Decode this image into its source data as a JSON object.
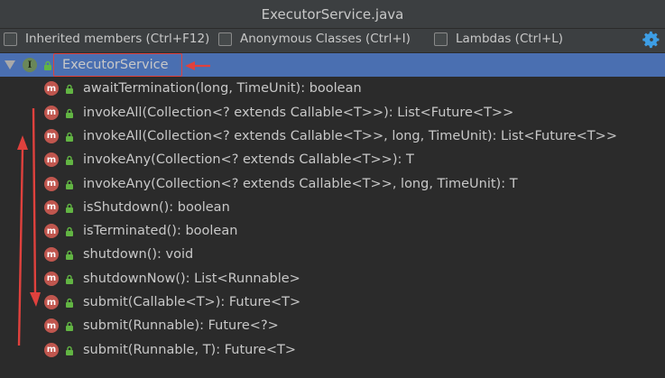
{
  "window": {
    "title": "ExecutorService.java"
  },
  "toolbar": {
    "inherited_label": "Inherited members (Ctrl+F12)",
    "anonymous_label": "Anonymous Classes (Ctrl+I)",
    "lambdas_label": "Lambdas (Ctrl+L)",
    "settings_icon": "gear-icon"
  },
  "tree": {
    "root": {
      "label": "ExecutorService",
      "badge": "I"
    },
    "method_badge": "m",
    "methods": [
      "awaitTermination(long, TimeUnit): boolean",
      "invokeAll(Collection<? extends Callable<T>>): List<Future<T>>",
      "invokeAll(Collection<? extends Callable<T>>, long, TimeUnit): List<Future<T>>",
      "invokeAny(Collection<? extends Callable<T>>): T",
      "invokeAny(Collection<? extends Callable<T>>, long, TimeUnit): T",
      "isShutdown(): boolean",
      "isTerminated(): boolean",
      "shutdown(): void",
      "shutdownNow(): List<Runnable>",
      "submit(Callable<T>): Future<T>",
      "submit(Runnable): Future<?>",
      "submit(Runnable, T): Future<T>"
    ]
  },
  "colors": {
    "selection": "#4a6fb1",
    "annotation": "#e0413d",
    "method_badge": "#c0564e",
    "interface_badge": "#6a8759"
  }
}
